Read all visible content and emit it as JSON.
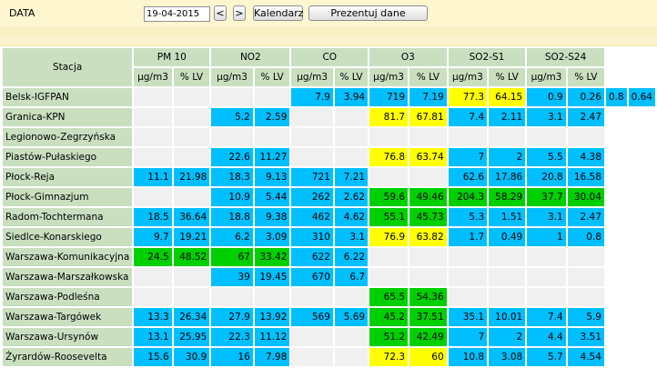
{
  "header": {
    "date_label": "DATA",
    "date_value": "19-04-2015",
    "prev_label": "<",
    "next_label": ">",
    "calendar_label": "Kalendarz",
    "present_label": "Prezentuj dane"
  },
  "table": {
    "station_header": "Stacja",
    "pollutants": [
      "PM 10",
      "NO2",
      "CO",
      "O3",
      "SO2-S1",
      "SO2-S24"
    ],
    "units": [
      "µg/m3",
      "% LV"
    ],
    "colors": {
      "blue": "#00bfff",
      "yellow": "#ffff00",
      "green": "#00d000",
      "empty": "#f0f0f0",
      "header": "#c9dfc0"
    },
    "rows": [
      {
        "name": "Belsk-IGFPAN",
        "cells": [
          [
            "",
            "",
            "e"
          ],
          [
            "",
            "",
            "e"
          ],
          [
            "7.9",
            "3.94",
            "b"
          ],
          [
            "719",
            "7.19",
            "b"
          ],
          [
            "77.3",
            "64.15",
            "y"
          ],
          [
            "0.9",
            "0.26",
            "b"
          ],
          [
            "0.8",
            "0.64",
            "b"
          ]
        ]
      },
      {
        "name": "Granica-KPN",
        "cells": [
          [
            "",
            "",
            "e"
          ],
          [
            "5.2",
            "2.59",
            "b"
          ],
          [
            "",
            "",
            "e"
          ],
          [
            "81.7",
            "67.81",
            "y"
          ],
          [
            "7.4",
            "2.11",
            "b"
          ],
          [
            "3.1",
            "2.47",
            "b"
          ]
        ]
      },
      {
        "name": "Legionowo-Zegrzyńska",
        "cells": [
          [
            "",
            "",
            "e"
          ],
          [
            "",
            "",
            "e"
          ],
          [
            "",
            "",
            "e"
          ],
          [
            "",
            "",
            "e"
          ],
          [
            "",
            "",
            "e"
          ],
          [
            "",
            "",
            "e"
          ]
        ]
      },
      {
        "name": "Piastów-Pułaskiego",
        "cells": [
          [
            "",
            "",
            "e"
          ],
          [
            "22.6",
            "11.27",
            "b"
          ],
          [
            "",
            "",
            "e"
          ],
          [
            "76.8",
            "63.74",
            "y"
          ],
          [
            "7",
            "2",
            "b"
          ],
          [
            "5.5",
            "4.38",
            "b"
          ]
        ]
      },
      {
        "name": "Płock-Reja",
        "cells": [
          [
            "11.1",
            "21.98",
            "b"
          ],
          [
            "18.3",
            "9.13",
            "b"
          ],
          [
            "721",
            "7.21",
            "b"
          ],
          [
            "",
            "",
            "e"
          ],
          [
            "62.6",
            "17.86",
            "b"
          ],
          [
            "20.8",
            "16.58",
            "b"
          ]
        ]
      },
      {
        "name": "Płock-Gimnazjum",
        "cells": [
          [
            "",
            "",
            "e"
          ],
          [
            "10.9",
            "5.44",
            "b"
          ],
          [
            "262",
            "2.62",
            "b"
          ],
          [
            "59.6",
            "49.46",
            "g"
          ],
          [
            "204.3",
            "58.29",
            "g"
          ],
          [
            "37.7",
            "30.04",
            "g"
          ]
        ]
      },
      {
        "name": "Radom-Tochtermana",
        "cells": [
          [
            "18.5",
            "36.64",
            "b"
          ],
          [
            "18.8",
            "9.38",
            "b"
          ],
          [
            "462",
            "4.62",
            "b"
          ],
          [
            "55.1",
            "45.73",
            "g"
          ],
          [
            "5.3",
            "1.51",
            "b"
          ],
          [
            "3.1",
            "2.47",
            "b"
          ]
        ]
      },
      {
        "name": "Siedlce-Konarskiego",
        "cells": [
          [
            "9.7",
            "19.21",
            "b"
          ],
          [
            "6.2",
            "3.09",
            "b"
          ],
          [
            "310",
            "3.1",
            "b"
          ],
          [
            "76.9",
            "63.82",
            "y"
          ],
          [
            "1.7",
            "0.49",
            "b"
          ],
          [
            "1",
            "0.8",
            "b"
          ]
        ]
      },
      {
        "name": "Warszawa-Komunikacyjna",
        "cells": [
          [
            "24.5",
            "48.52",
            "g"
          ],
          [
            "67",
            "33.42",
            "g"
          ],
          [
            "622",
            "6.22",
            "b"
          ],
          [
            "",
            "",
            "e"
          ],
          [
            "",
            "",
            "e"
          ],
          [
            "",
            "",
            "e"
          ]
        ]
      },
      {
        "name": "Warszawa-Marszałkowska",
        "cells": [
          [
            "",
            "",
            "e"
          ],
          [
            "39",
            "19.45",
            "b"
          ],
          [
            "670",
            "6.7",
            "b"
          ],
          [
            "",
            "",
            "e"
          ],
          [
            "",
            "",
            "e"
          ],
          [
            "",
            "",
            "e"
          ]
        ]
      },
      {
        "name": "Warszawa-Podleśna",
        "cells": [
          [
            "",
            "",
            "e"
          ],
          [
            "",
            "",
            "e"
          ],
          [
            "",
            "",
            "e"
          ],
          [
            "65.5",
            "54.36",
            "g"
          ],
          [
            "",
            "",
            "e"
          ],
          [
            "",
            "",
            "e"
          ]
        ]
      },
      {
        "name": "Warszawa-Targówek",
        "cells": [
          [
            "13.3",
            "26.34",
            "b"
          ],
          [
            "27.9",
            "13.92",
            "b"
          ],
          [
            "569",
            "5.69",
            "b"
          ],
          [
            "45.2",
            "37.51",
            "g"
          ],
          [
            "35.1",
            "10.01",
            "b"
          ],
          [
            "7.4",
            "5.9",
            "b"
          ]
        ]
      },
      {
        "name": "Warszawa-Ursynów",
        "cells": [
          [
            "13.1",
            "25.95",
            "b"
          ],
          [
            "22.3",
            "11.12",
            "b"
          ],
          [
            "",
            "",
            "e"
          ],
          [
            "51.2",
            "42.49",
            "g"
          ],
          [
            "7",
            "2",
            "b"
          ],
          [
            "4.4",
            "3.51",
            "b"
          ]
        ]
      },
      {
        "name": "Żyrardów-Roosevelta",
        "cells": [
          [
            "15.6",
            "30.9",
            "b"
          ],
          [
            "16",
            "7.98",
            "b"
          ],
          [
            "",
            "",
            "e"
          ],
          [
            "72.3",
            "60",
            "y"
          ],
          [
            "10.8",
            "3.08",
            "b"
          ],
          [
            "5.7",
            "4.54",
            "b"
          ]
        ]
      }
    ]
  }
}
